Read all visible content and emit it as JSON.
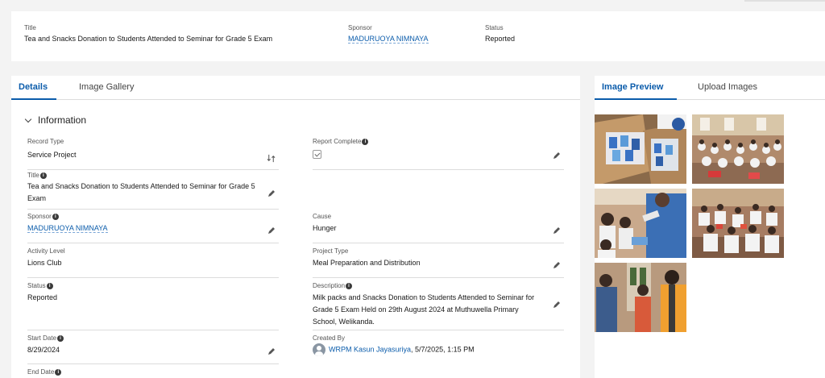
{
  "header": {
    "title_label": "Title",
    "title_value": "Tea and Snacks Donation to Students Attended to Seminar for Grade 5 Exam",
    "sponsor_label": "Sponsor",
    "sponsor_value": "MADURUOYA NIMNAYA",
    "status_label": "Status",
    "status_value": "Reported"
  },
  "left_tabs": {
    "details": "Details",
    "gallery": "Image Gallery"
  },
  "section": {
    "title": "Information"
  },
  "fields": {
    "record_type": {
      "label": "Record Type",
      "value": "Service Project"
    },
    "report_complete": {
      "label": "Report Complete"
    },
    "title": {
      "label": "Title",
      "value": "Tea and Snacks Donation to Students Attended to Seminar for Grade 5 Exam"
    },
    "sponsor": {
      "label": "Sponsor",
      "value": "MADURUOYA NIMNAYA"
    },
    "cause": {
      "label": "Cause",
      "value": "Hunger"
    },
    "activity_level": {
      "label": "Activity Level",
      "value": "Lions Club"
    },
    "project_type": {
      "label": "Project Type",
      "value": "Meal Preparation and Distribution"
    },
    "status": {
      "label": "Status",
      "value": "Reported"
    },
    "description": {
      "label": "Description",
      "value": "Milk packs and Snacks Donation to Students Attended to Seminar for Grade 5 Exam Held on 29th August 2024 at Muthuwella Primary School, Welikanda."
    },
    "start_date": {
      "label": "Start Date",
      "value": "8/29/2024"
    },
    "created_by": {
      "label": "Created By",
      "user": "WRPM Kasun Jayasuriya",
      "date": ", 5/7/2025, 1:15 PM"
    },
    "end_date": {
      "label": "End Date"
    }
  },
  "right_tabs": {
    "preview": "Image Preview",
    "upload": "Upload Images"
  },
  "colors": {
    "accent": "#0b5cab",
    "page_bg": "#f3f3f3",
    "card_bg": "#ffffff"
  },
  "icons": [
    "chevron-down-icon",
    "info-icon",
    "pencil-icon",
    "swap-icon",
    "checkbox-icon",
    "avatar-icon"
  ]
}
